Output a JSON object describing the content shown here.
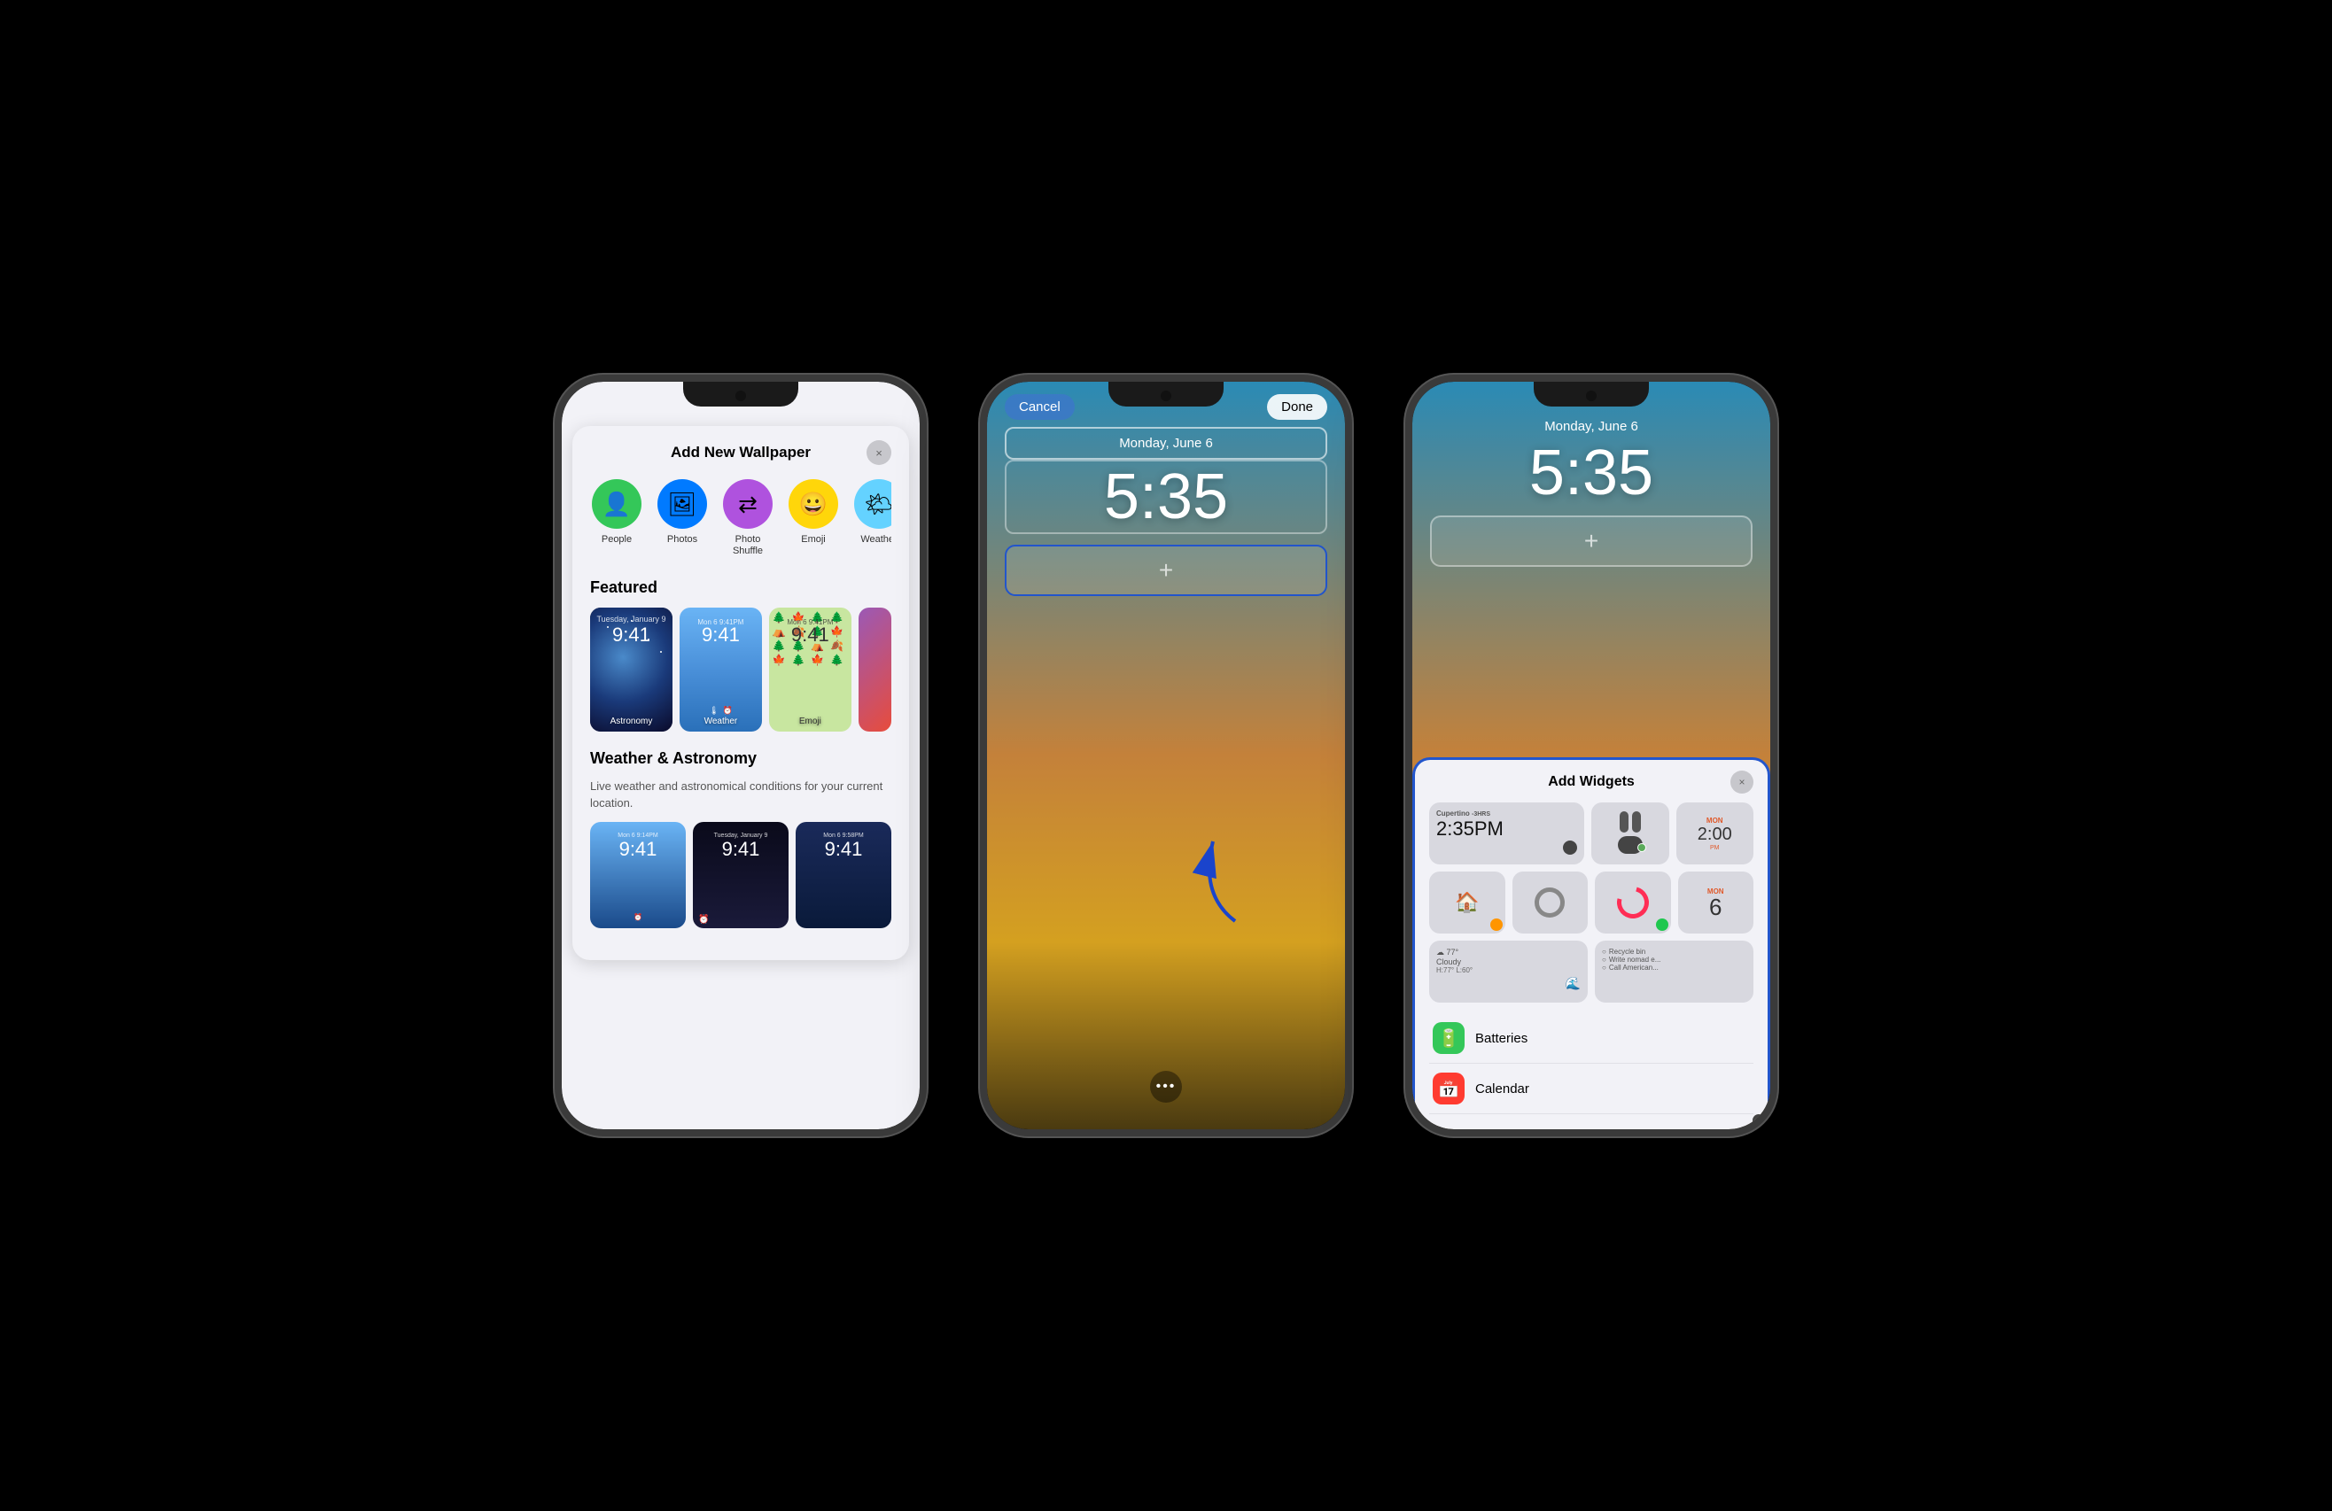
{
  "phones": [
    {
      "id": "phone1",
      "modal": {
        "title": "Add New Wallpaper",
        "close_label": "×",
        "types": [
          {
            "id": "people",
            "label": "People",
            "bg": "#34c759",
            "icon": "👤"
          },
          {
            "id": "photos",
            "label": "Photos",
            "bg": "#007aff",
            "icon": "🖼"
          },
          {
            "id": "photo-shuffle",
            "label": "Photo Shuffle",
            "bg": "#af52de",
            "icon": "⇄"
          },
          {
            "id": "emoji",
            "label": "Emoji",
            "bg": "#ffd60a",
            "icon": "😀"
          },
          {
            "id": "weather",
            "label": "Weather",
            "bg": "#64d2ff",
            "icon": "🌤"
          }
        ],
        "featured_label": "Featured",
        "featured_items": [
          {
            "label": "Astronomy",
            "time": "Tuesday, January 9",
            "clock": "9:41"
          },
          {
            "label": "Weather",
            "time": "Mon 6  9:41PM",
            "clock": "9:41"
          },
          {
            "label": "Emoji",
            "time": "Mon 6  9:41PM",
            "clock": "9:41"
          }
        ],
        "weather_section": {
          "title": "Weather & Astronomy",
          "desc": "Live weather and astronomical conditions for your current location.",
          "items": [
            {
              "time": "Mon 6  9:14PM",
              "clock": "9:41"
            },
            {
              "time": "Tuesday, January 9",
              "clock": "9:41"
            },
            {
              "time": "Mon 6  9:58PM",
              "clock": "9:41"
            }
          ]
        }
      }
    },
    {
      "id": "phone2",
      "cancel_label": "Cancel",
      "done_label": "Done",
      "date": "Monday, June 6",
      "time": "5:35",
      "widget_plus": "+",
      "three_dots": "•••"
    },
    {
      "id": "phone3",
      "date": "Monday, June 6",
      "time": "5:35",
      "widget_plus": "+",
      "add_widgets_panel": {
        "title": "Add Widgets",
        "close_label": "×",
        "widgets_row1": [
          {
            "type": "weather-clock",
            "city": "Cupertino",
            "offset": "-3HRS",
            "time": "2:35PM"
          },
          {
            "type": "airpods"
          },
          {
            "type": "calendar-mini",
            "day": "MON",
            "date": "2:00",
            "label": "PM"
          }
        ],
        "widgets_row2": [
          {
            "type": "home"
          },
          {
            "type": "gray"
          },
          {
            "type": "activity"
          },
          {
            "type": "calendar-day",
            "day": "MON",
            "date": "6"
          }
        ],
        "widgets_row3": [
          {
            "type": "weather-wide",
            "temp": "77°",
            "condition": "Cloudy",
            "high": "H:77° L:60°"
          },
          {
            "type": "reminders",
            "items": [
              "Recycle bin",
              "Write nomad e...",
              "Call American..."
            ]
          }
        ],
        "app_list": [
          {
            "name": "Batteries",
            "icon": "🔋",
            "color": "#34c759"
          },
          {
            "name": "Calendar",
            "icon": "📅",
            "color": "#ff3b30"
          }
        ]
      }
    }
  ]
}
